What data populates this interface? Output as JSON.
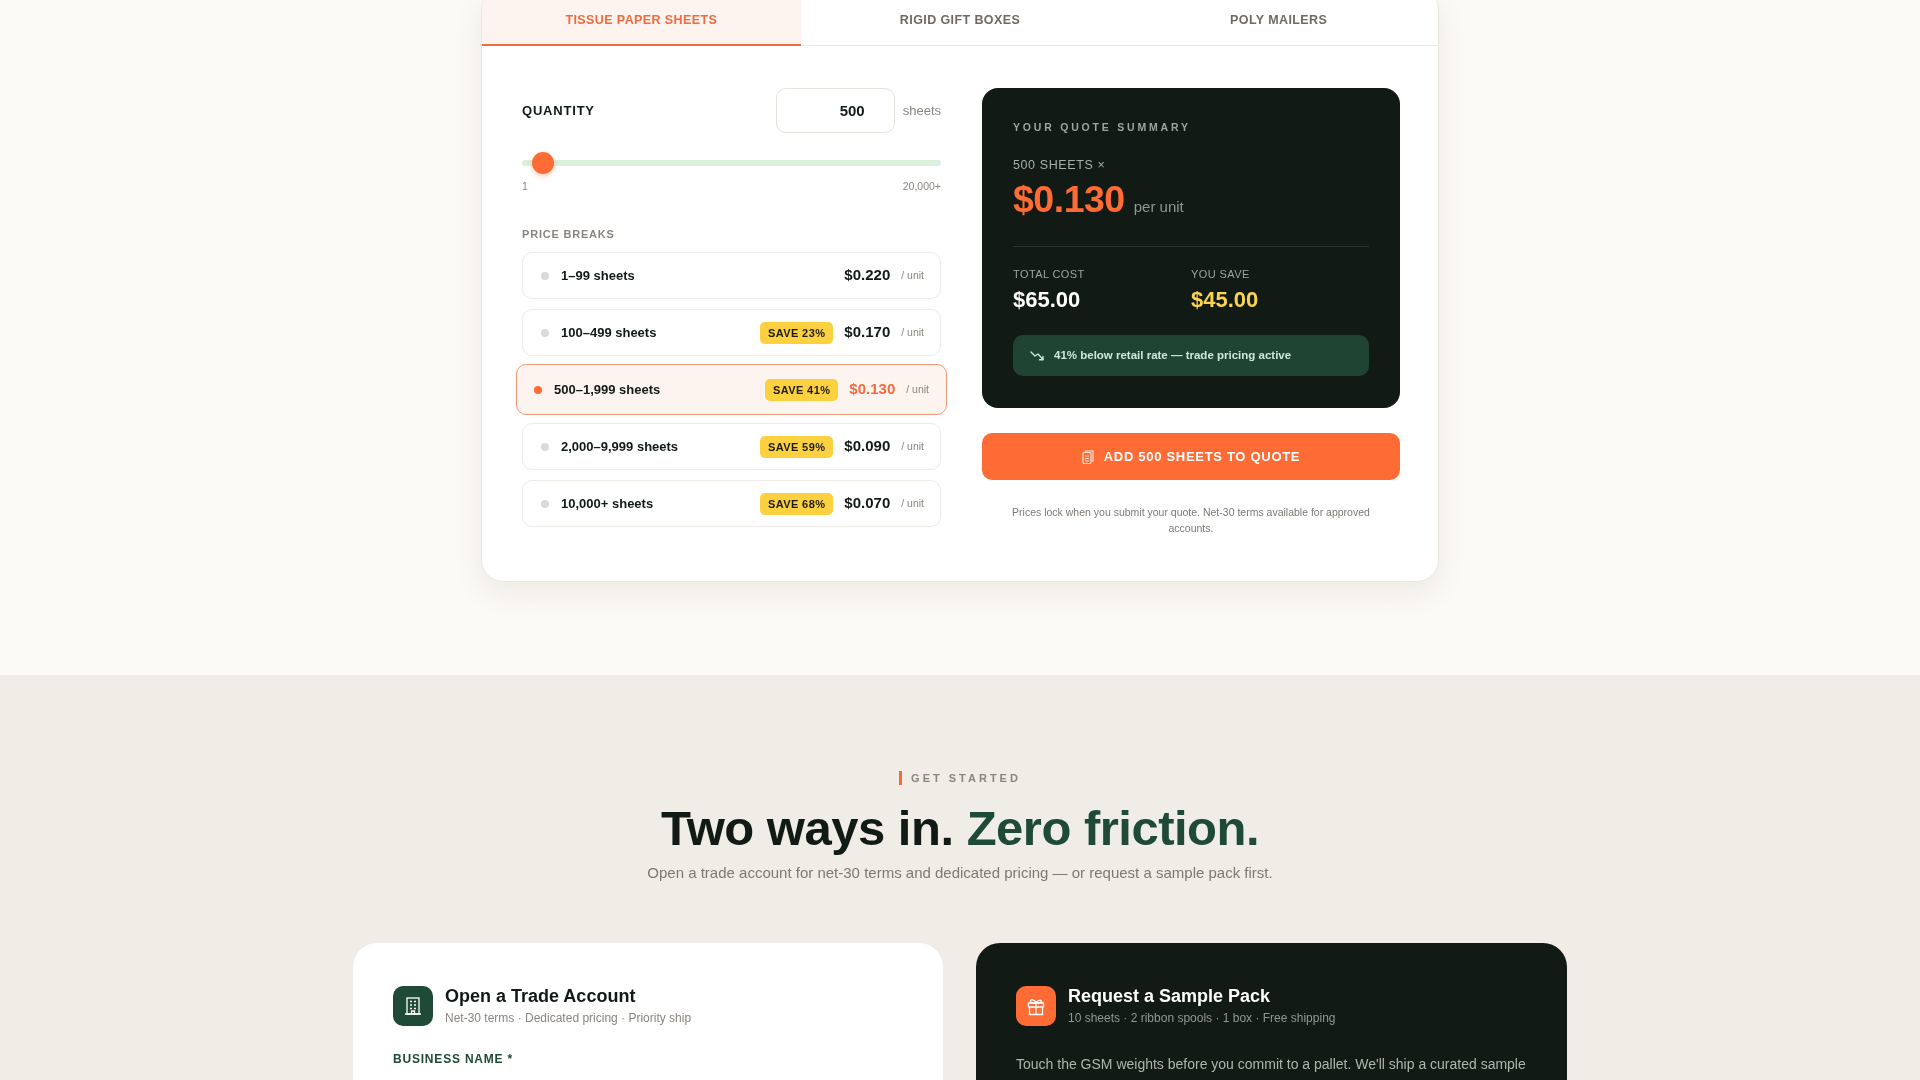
{
  "tabs": [
    {
      "label": "TISSUE PAPER SHEETS",
      "selected": true
    },
    {
      "label": "RIGID GIFT BOXES",
      "selected": false
    },
    {
      "label": "POLY MAILERS",
      "selected": false
    }
  ],
  "quantity": {
    "label": "QUANTITY",
    "value": "500",
    "unit": "sheets",
    "slider": {
      "level": 0.025,
      "min_label": "1",
      "max_label": "20,000+"
    }
  },
  "price_breaks": {
    "title": "PRICE BREAKS",
    "tiers": [
      {
        "label": "1–99 sheets",
        "price": "$0.220",
        "unit": "/ unit",
        "selected": false
      },
      {
        "label": "100–499 sheets",
        "badge": "SAVE 23%",
        "price": "$0.170",
        "unit": "/ unit",
        "selected": false
      },
      {
        "label": "500–1,999 sheets",
        "badge": "SAVE 41%",
        "price": "$0.130",
        "unit": "/ unit",
        "selected": true
      },
      {
        "label": "2,000–9,999 sheets",
        "badge": "SAVE 59%",
        "price": "$0.090",
        "unit": "/ unit",
        "selected": false
      },
      {
        "label": "10,000+ sheets",
        "badge": "SAVE 68%",
        "price": "$0.070",
        "unit": "/ unit",
        "selected": false
      }
    ]
  },
  "summary": {
    "title": "YOUR QUOTE SUMMARY",
    "quantity_line": "500 SHEETS ×",
    "unit_price": "$0.130",
    "unit_price_suffix": "per unit",
    "total_label": "TOTAL COST",
    "total": "$65.00",
    "save_label": "YOU SAVE",
    "save": "$45.00",
    "note": "41% below retail rate — trade pricing active"
  },
  "add_button": "ADD 500 SHEETS TO QUOTE",
  "footnote": "Prices lock when you submit your quote. Net-30 terms available for approved accounts.",
  "get_started": {
    "eyebrow": "GET STARTED",
    "heading": [
      {
        "text": "Two ways in.",
        "accent": false
      },
      {
        "text": "Zero friction.",
        "accent": true
      }
    ],
    "subtitle": "Open a trade account for net-30 terms and dedicated pricing — or request a sample pack first."
  },
  "cards": [
    {
      "kind": "form",
      "title": "Open a Trade Account",
      "subtitle": "Net-30 terms · Dedicated pricing · Priority ship",
      "field_label": "BUSINESS NAME *"
    },
    {
      "kind": "sample",
      "title": "Request a Sample Pack",
      "subtitle": "10 sheets · 2 ribbon spools · 1 box · Free shipping",
      "body": "Touch the GSM weights before you commit to a pallet. We'll ship a curated sample"
    }
  ]
}
